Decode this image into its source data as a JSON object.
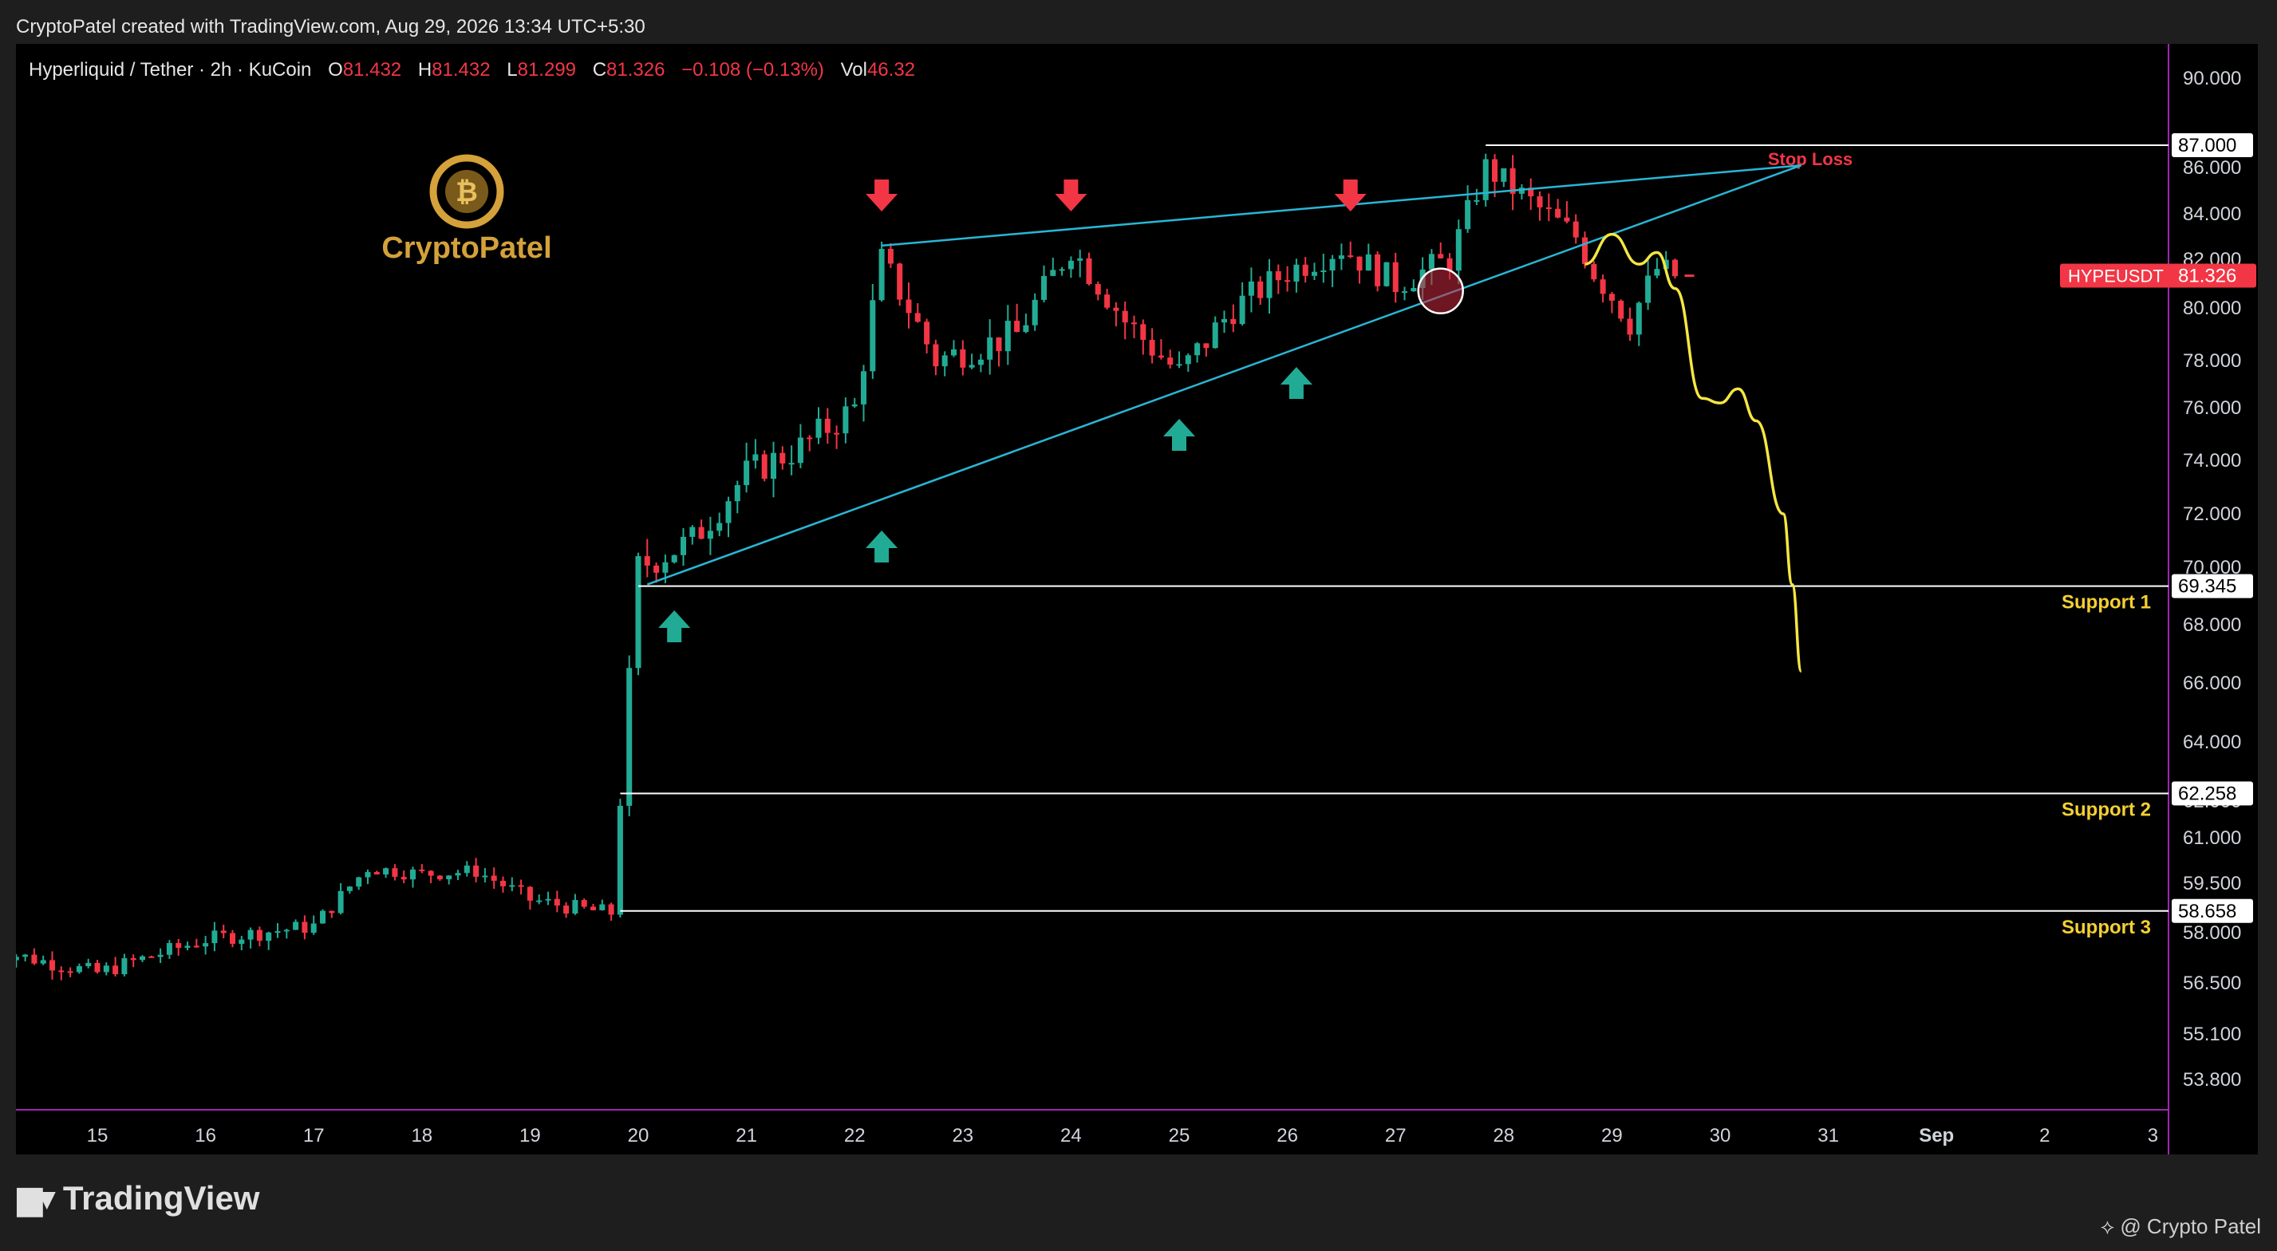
{
  "credit": "CryptoPatel created with TradingView.com, Aug 29, 2026 13:34 UTC+5:30",
  "legend": {
    "pair": "Hyperliquid / Tether · 2h · KuCoin",
    "o_label": "O",
    "o": "81.432",
    "h_label": "H",
    "h": "81.432",
    "l_label": "L",
    "l": "81.299",
    "c_label": "C",
    "c": "81.326",
    "change": "−0.108 (−0.13%)",
    "vol_label": "Vol",
    "vol": "46.32"
  },
  "logo_text": "CryptoPatel",
  "footer": {
    "brand": "TradingView",
    "author": "@ Crypto Patel"
  },
  "colors": {
    "up": "#22ab94",
    "down": "#f23645",
    "trend": "#29b6d6",
    "projection": "#f5e642",
    "level": "#ffffff",
    "support_text": "#f5d033",
    "stop_text": "#f23645",
    "axis_line": "#9c27b0"
  },
  "chart_data": {
    "type": "candlestick",
    "symbol": "HYPEUSDT",
    "last_price": "81.326",
    "y_ticks": [
      "90.000",
      "86.000",
      "84.000",
      "82.000",
      "80.000",
      "78.000",
      "76.000",
      "74.000",
      "72.000",
      "70.000",
      "68.000",
      "66.000",
      "64.000",
      "62.000",
      "61.000",
      "59.500",
      "58.000",
      "56.500",
      "55.100",
      "53.800"
    ],
    "x_ticks": [
      "15",
      "16",
      "17",
      "18",
      "19",
      "20",
      "21",
      "22",
      "23",
      "24",
      "25",
      "26",
      "27",
      "28",
      "29",
      "30",
      "31",
      "Sep",
      "2",
      "3"
    ],
    "levels": [
      {
        "name": "Stop Loss",
        "price": "87.000"
      },
      {
        "name": "Support 1",
        "price": "69.345"
      },
      {
        "name": "Support 2",
        "price": "62.258"
      },
      {
        "name": "Support 3",
        "price": "58.658"
      }
    ],
    "trendlines": [
      {
        "from": [
          "20 02:00",
          69.4
        ],
        "to": [
          "30 18:00",
          86.1
        ]
      },
      {
        "from": [
          "22 06:00",
          82.6
        ],
        "to": [
          "30 18:00",
          86.1
        ]
      }
    ],
    "down_arrows": [
      "22 06:00",
      "24 00:00",
      "26 14:00"
    ],
    "up_arrows": [
      "20 08:00",
      "22 06:00",
      "25 00:00",
      "26 02:00"
    ],
    "highlight_circle": [
      "27 10:00",
      80.7
    ],
    "projection": [
      [
        "28 18:00",
        81.8
      ],
      [
        "29 00:00",
        83.1
      ],
      [
        "29 06:00",
        81.8
      ],
      [
        "29 10:00",
        82.3
      ],
      [
        "29 14:00",
        80.8
      ],
      [
        "29 20:00",
        76.4
      ],
      [
        "30 00:00",
        76.2
      ],
      [
        "30 04:00",
        76.8
      ],
      [
        "30 08:00",
        75.5
      ],
      [
        "30 14:00",
        72.0
      ],
      [
        "30 16:00",
        69.4
      ],
      [
        "30 18:00",
        66.4
      ]
    ],
    "candles_summary": [
      [
        "14 00:00",
        57.5
      ],
      [
        "15 00:00",
        56.8
      ],
      [
        "16 00:00",
        57.8
      ],
      [
        "17 00:00",
        58.2
      ],
      [
        "17 12:00",
        60.0
      ],
      [
        "18 00:00",
        59.8
      ],
      [
        "18 12:00",
        59.9
      ],
      [
        "19 00:00",
        59.0
      ],
      [
        "19 12:00",
        58.7
      ],
      [
        "19 18:00",
        58.6
      ],
      [
        "19 20:00",
        62.0
      ],
      [
        "20 00:00",
        70.0
      ],
      [
        "20 12:00",
        71.0
      ],
      [
        "21 00:00",
        73.5
      ],
      [
        "21 12:00",
        74.5
      ],
      [
        "22 00:00",
        76.0
      ],
      [
        "22 06:00",
        82.0
      ],
      [
        "22 18:00",
        78.0
      ],
      [
        "23 12:00",
        79.0
      ],
      [
        "24 00:00",
        82.5
      ],
      [
        "24 12:00",
        79.5
      ],
      [
        "25 00:00",
        77.5
      ],
      [
        "25 12:00",
        80.0
      ],
      [
        "26 00:00",
        81.5
      ],
      [
        "26 12:00",
        82.5
      ],
      [
        "27 00:00",
        81.0
      ],
      [
        "27 12:00",
        82.0
      ],
      [
        "27 20:00",
        86.0
      ],
      [
        "28 06:00",
        84.5
      ],
      [
        "28 16:00",
        83.0
      ],
      [
        "28 20:00",
        81.5
      ],
      [
        "29 04:00",
        79.5
      ],
      [
        "29 10:00",
        81.6
      ],
      [
        "29 14:00",
        81.326
      ]
    ]
  }
}
